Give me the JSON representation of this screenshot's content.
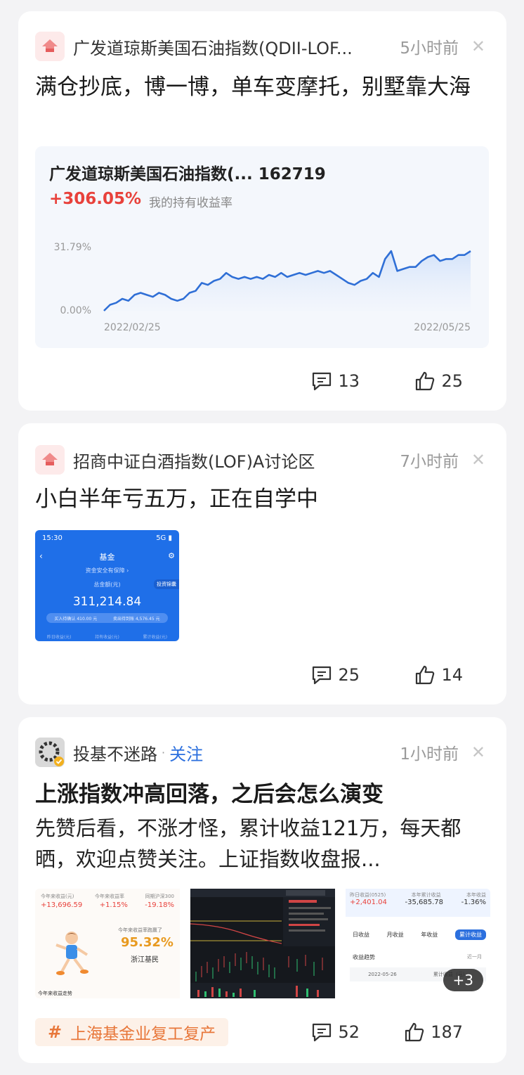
{
  "posts": [
    {
      "source": "广发道琼斯美国石油指数(QDII-LOF...",
      "time": "5小时前",
      "title": "满仓抄底，博一博，单车变摩托，别墅靠大海",
      "chart_card": {
        "name": "广发道琼斯美国石油指数(... 162719",
        "return_value": "+306.05%",
        "return_label": "我的持有收益率"
      },
      "comments": "13",
      "likes": "25"
    },
    {
      "source": "招商中证白酒指数(LOF)A讨论区",
      "time": "7小时前",
      "title": "小白半年亏五万，正在自学中",
      "screenshot": {
        "time": "15:30",
        "signal": "5G",
        "title": "基金",
        "banner": "资金安全有保障 ›",
        "total_label": "总金额(元)",
        "total": "311,214.84",
        "side_btn": "投资锦囊",
        "pending_in": "买入待确认 410.00 元",
        "pending_out": "卖出待到账 4,576.45 元",
        "tabs": [
          "昨日收益(元)",
          "持有收益(元)",
          "累计收益(元)"
        ]
      },
      "comments": "25",
      "likes": "14"
    },
    {
      "source": "投基不迷路",
      "follow": "关注",
      "time": "1小时前",
      "title": "上涨指数冲高回落，之后会怎么演变",
      "body": "先赞后看，不涨才怪，累计收益121万，每天都晒，欢迎点赞关注。上证指数收盘报...",
      "thumb1": {
        "labels": [
          "今年来收益(元)",
          "今年来收益率",
          "同期沪深300"
        ],
        "values": [
          "+13,696.59",
          "+1.15%",
          "-19.18%"
        ],
        "beat_label": "今年来收益率跑赢了",
        "beat_value": "95.32%",
        "beat_region": "浙江基民",
        "footer": "今年来收益走势"
      },
      "thumb3": {
        "labels": [
          "昨日收益(0525)",
          "本年累计收益",
          "本年收益"
        ],
        "values": [
          "+2,401.04",
          "-35,685.78",
          "-1.36%"
        ],
        "tabs": [
          "日收益",
          "月收益",
          "年收益",
          "累计收益"
        ],
        "trend_label": "收益趋势",
        "period": "近一月",
        "date": "2022-05-26",
        "cum_label": "累计收益（元）",
        "more": "+3"
      },
      "topic": "上海基金业复工复产",
      "comments": "52",
      "likes": "187"
    }
  ],
  "chart_data": {
    "type": "area",
    "x": [
      "2022/02/25",
      "",
      "",
      "",
      "",
      "",
      "",
      "",
      "",
      "",
      "",
      "",
      "",
      "",
      "",
      "",
      "",
      "",
      "",
      "",
      "",
      "",
      "",
      "",
      "",
      "",
      "",
      "",
      "",
      "",
      "",
      "",
      "",
      "",
      "",
      "",
      "",
      "",
      "",
      "",
      "",
      "",
      "",
      "",
      "",
      "",
      "",
      "",
      "",
      "",
      "",
      "",
      "",
      "",
      "",
      "",
      "",
      "",
      "",
      "",
      "",
      "",
      "",
      "2022/05/25"
    ],
    "xlabels": [
      "2022/02/25",
      "2022/05/25"
    ],
    "ylabels": [
      "31.79%",
      "0.00%"
    ],
    "ylim": [
      0,
      31.79
    ],
    "values": [
      0,
      3,
      4,
      6,
      5,
      8,
      9,
      8,
      7,
      9,
      8,
      6,
      5,
      6,
      9,
      10,
      14,
      13,
      15,
      16,
      19,
      17,
      16,
      17,
      16,
      17,
      16,
      18,
      17,
      19,
      17,
      18,
      19,
      18,
      19,
      20,
      19,
      20,
      18,
      16,
      14,
      13,
      15,
      16,
      19,
      17,
      26,
      30,
      20,
      21,
      22,
      22,
      25,
      27,
      28,
      25,
      26,
      26,
      28,
      28,
      30
    ]
  },
  "colors": {
    "accent": "#2b6fde",
    "red": "#e8413b",
    "chart_line": "#2f6fd6",
    "topic": "#e8773a"
  }
}
